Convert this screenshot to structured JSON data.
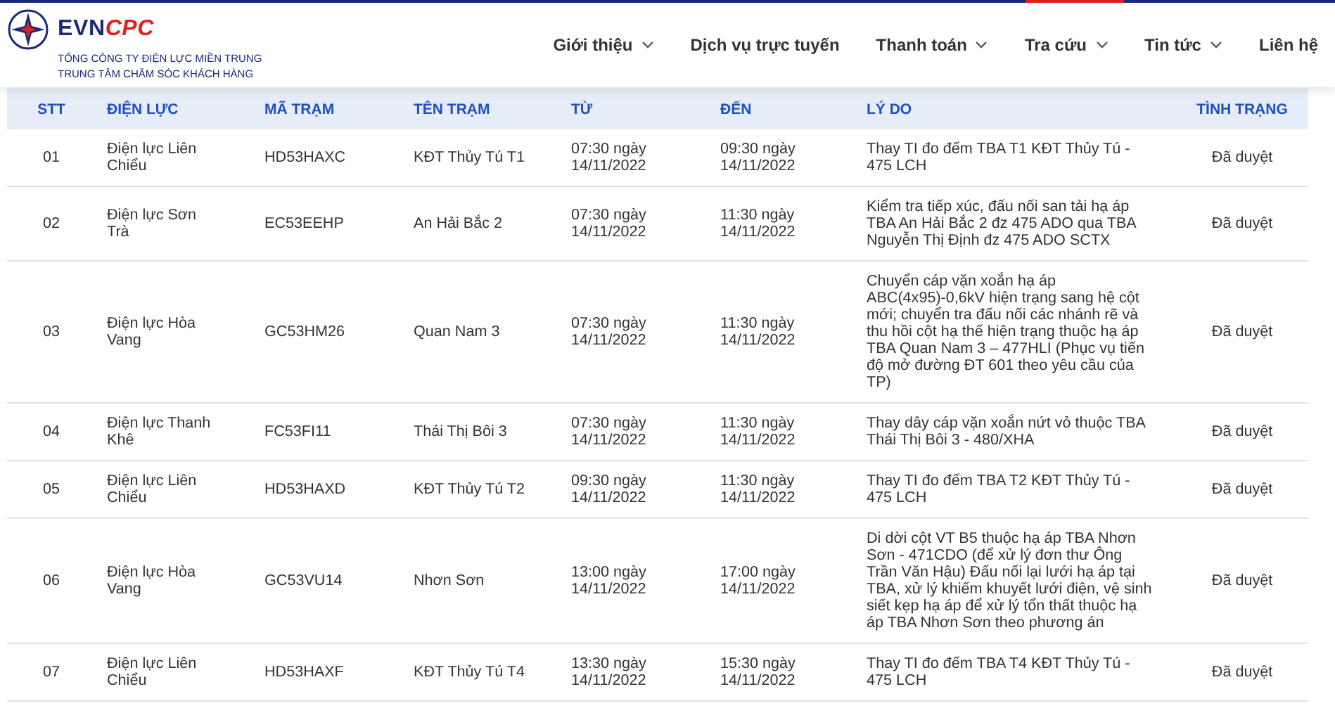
{
  "header": {
    "logo": {
      "brand_main": "EVN",
      "brand_accent": "CPC",
      "subtitle_1": "TỔNG CÔNG TY ĐIỆN LỰC MIỀN TRUNG",
      "subtitle_2": "TRUNG TÂM CHĂM SÓC KHÁCH HÀNG"
    },
    "nav": [
      {
        "label": "Giới thiệu",
        "dropdown": true
      },
      {
        "label": "Dịch vụ trực tuyến",
        "dropdown": false
      },
      {
        "label": "Thanh toán",
        "dropdown": true
      },
      {
        "label": "Tra cứu",
        "dropdown": true
      },
      {
        "label": "Tin tức",
        "dropdown": true
      },
      {
        "label": "Liên hệ",
        "dropdown": false
      }
    ]
  },
  "table": {
    "columns": [
      "STT",
      "ĐIỆN LỰC",
      "MÃ TRẠM",
      "TÊN TRẠM",
      "TỪ",
      "ĐẾN",
      "LÝ DO",
      "TÌNH TRẠNG"
    ],
    "rows": [
      [
        "01",
        "Điện lực Liên Chiểu",
        "HD53HAXC",
        "KĐT Thủy Tú T1",
        "07:30 ngày 14/11/2022",
        "09:30 ngày 14/11/2022",
        "Thay TI đo đếm TBA T1 KĐT Thủy Tú - 475 LCH",
        "Đã duyệt"
      ],
      [
        "02",
        "Điện lực Sơn Trà",
        "EC53EEHP",
        "An Hải Bắc 2",
        "07:30 ngày 14/11/2022",
        "11:30 ngày 14/11/2022",
        "Kiểm tra tiếp xúc, đấu nối san tải hạ áp TBA An Hải Bắc 2 đz 475 ADO qua TBA Nguyễn Thị Định đz 475 ADO SCTX",
        "Đã duyệt"
      ],
      [
        "03",
        "Điện lực Hòa Vang",
        "GC53HM26",
        "Quan Nam 3",
        "07:30 ngày 14/11/2022",
        "11:30 ngày 14/11/2022",
        "Chuyển cáp vặn xoắn hạ áp ABC(4x95)-0,6kV hiện trạng sang hệ cột mới; chuyển tra đấu nối các nhánh rẽ và thu hồi cột hạ thế hiện trạng thuộc hạ áp TBA Quan Nam 3 – 477HLI (Phục vụ tiến độ mở đường ĐT 601 theo yêu cầu của TP)",
        "Đã duyệt"
      ],
      [
        "04",
        "Điện lực Thanh Khê",
        "FC53FI11",
        "Thái Thị Bôi 3",
        "07:30 ngày 14/11/2022",
        "11:30 ngày 14/11/2022",
        "Thay dây cáp vặn xoắn nứt vỏ thuộc TBA Thái Thị Bôi 3 - 480/XHA",
        "Đã duyệt"
      ],
      [
        "05",
        "Điện lực Liên Chiểu",
        "HD53HAXD",
        "KĐT Thủy Tú T2",
        "09:30 ngày 14/11/2022",
        "11:30 ngày 14/11/2022",
        "Thay TI đo đếm TBA T2 KĐT Thủy Tú - 475 LCH",
        "Đã duyệt"
      ],
      [
        "06",
        "Điện lực Hòa Vang",
        "GC53VU14",
        "Nhơn Sơn",
        "13:00 ngày 14/11/2022",
        "17:00 ngày 14/11/2022",
        "Di dời cột VT B5 thuộc hạ áp TBA Nhơn Sơn - 471CDO (để xử lý đơn thư Ông Trần Văn Hậu) Đấu nối lại lưới hạ áp tại TBA, xử lý khiếm khuyết lưới điện, vệ sinh siết kẹp hạ áp để xử lý tổn thất thuộc hạ áp TBA Nhơn Sơn theo phương án",
        "Đã duyệt"
      ],
      [
        "07",
        "Điện lực Liên Chiểu",
        "HD53HAXF",
        "KĐT Thủy Tú T4",
        "13:30 ngày 14/11/2022",
        "15:30 ngày 14/11/2022",
        "Thay TI đo đếm TBA T4 KĐT Thủy Tú - 475 LCH",
        "Đã duyệt"
      ]
    ]
  }
}
